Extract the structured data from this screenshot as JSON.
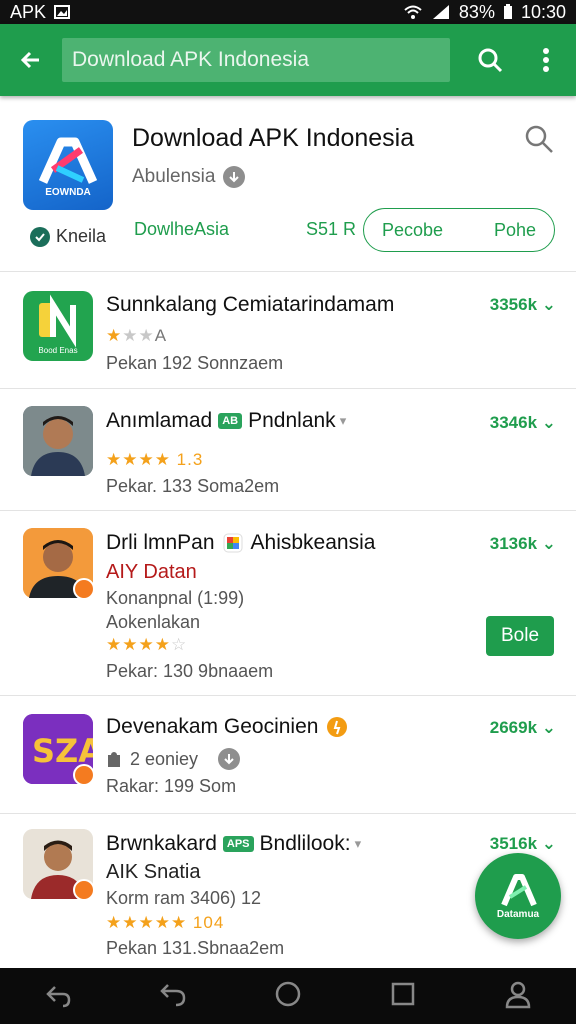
{
  "status_bar": {
    "carrier": "APK",
    "battery": "83%",
    "time": "10:30"
  },
  "toolbar": {
    "search_value": "Download APK Indonesia"
  },
  "header": {
    "app_title": "Download APK Indonesia",
    "developer": "Abulensia",
    "badge_label": "Kneila",
    "icon_label": "EOWNDA",
    "category": "DowlheAsia",
    "size": "S51 R",
    "btn_left": "Pecobe",
    "btn_right": "Pohe"
  },
  "items": [
    {
      "title": "Sunnkalang Cemiatarindamam",
      "stars_on": "★",
      "stars_off": "★★",
      "rating_label": "A",
      "meta": "Pekan 192 Sonnzaem",
      "count": "3356k",
      "thumb_color": "#22a44f",
      "thumb_label": "Bood Enas"
    },
    {
      "title_a": "Anımlamad",
      "tag": "AB",
      "title_b": "Pndnlank",
      "stars_text": "★★★★ 1.3",
      "meta": "Pekar. 133 Soma2em",
      "count": "3346k"
    },
    {
      "title_a": "Drli lmnPan",
      "title_b": "Ahisbkeansia",
      "line2": "AIY Datan",
      "line3": "Konanpnal (1:99)",
      "line4": "Aokenlakan",
      "stars_on": "★★★★",
      "stars_off": "☆",
      "meta": "Pekar: 130 9bnaaem",
      "count": "3136k",
      "action": "Bole"
    },
    {
      "title": "Devenakam Geocinien",
      "downloads": "2 eoniey",
      "meta": "Rakar: 199 Som",
      "count": "2669k",
      "thumb_color": "#7b2fbf",
      "thumb_label": "SZA"
    },
    {
      "title_a": "Brwnkakard",
      "tag": "APS",
      "title_b": "Bndlilook:",
      "line2": "AIK Snatia",
      "line3": "Korm ram 3406) 12",
      "stars_text": "★★★★★ 104",
      "meta": "Pekan 131.Sbnaa2em",
      "count": "3516k"
    }
  ],
  "fab": {
    "label": "Datamua"
  },
  "colors": {
    "primary": "#1f9d4d",
    "status_bar": "#111111",
    "nav_bar": "#0b0b0b"
  }
}
